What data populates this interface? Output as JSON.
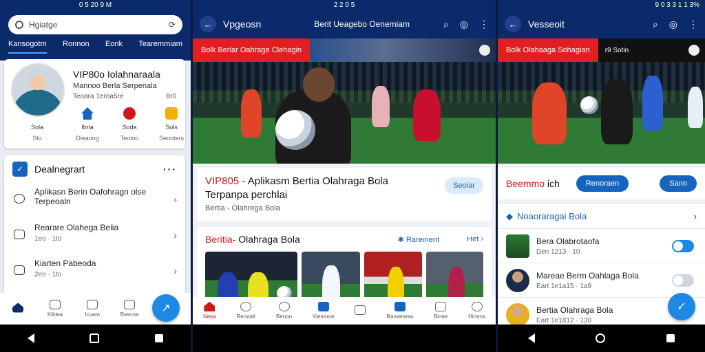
{
  "screen1": {
    "status": "0 5 20 9 M",
    "search": {
      "placeholder": "Hgiatge"
    },
    "tabs": [
      "Kansogotm",
      "Ronnon",
      "Eonk",
      "Tearemmiam"
    ],
    "profile": {
      "title": "VIP80o Iolahnaraala",
      "subtitle": "Mannoo Berla Serpenala",
      "meta_left": "Teoara 1eroa5re",
      "meta_right": "8r0",
      "avatar_caption1": "Sola",
      "avatar_caption2": "Sto",
      "quick": [
        {
          "label1": "Ibria",
          "label2": "Dieaong",
          "icon": "home-icon",
          "color": "#1565c0"
        },
        {
          "label1": "Soda",
          "label2": "Teoloo",
          "icon": "ball-icon",
          "color": "#d01818"
        },
        {
          "label1": "Sols",
          "label2": "Senntars",
          "icon": "ticket-icon",
          "color": "#f0b000"
        }
      ]
    },
    "list": {
      "heading": "Dealnegrart",
      "items": [
        {
          "title": "Aplikasn Berin Oafohragn olse Terpeoaln",
          "meta": ""
        },
        {
          "title": "Rearare Olahega Belia",
          "meta": "1eo · 1to"
        },
        {
          "title": "Kiarten Pabeoda",
          "meta": "2eo · 1to"
        }
      ]
    },
    "bottom_nav": [
      "",
      "Kiblea",
      "Icoam",
      "Bssnna"
    ]
  },
  "screen2": {
    "status": "2 2 0 5",
    "app_title": "Vpgeosn",
    "app_subtitle": "Berit Ueagebo Oenemiam",
    "banner": {
      "red_text": "Bolk Berlar Oahrage Clehagin"
    },
    "title_card": {
      "highlight": "VIP805",
      "title_rest": " - Aplikasm Bertia Olahraga Bola Terpanpa perchlai",
      "subtitle": "Bertia - Olahrega Bola",
      "pill": "Seoiar"
    },
    "news": {
      "highlight": "Beritia",
      "heading_rest": " - Olahraga Bola",
      "link1": "Rarement",
      "link2": "Het"
    },
    "bottom_tabs": [
      "Nesa",
      "Rerstalt",
      "Benoo",
      "Viemnoe",
      "",
      "Ramenesa",
      "Binee",
      "Himms"
    ]
  },
  "screen3": {
    "status": "9 0 3 3 1 1 3%",
    "app_title": "Vesseoit",
    "banner": {
      "red_text": "Bolk Olahaaga Sohagian",
      "rest_text": "r9 Sotin"
    },
    "row": {
      "highlight": "Beemmo",
      "text_rest": " ich",
      "btn1": "Renoraen",
      "btn2": "Sann"
    },
    "section": "Noaoraragai Bola",
    "items": [
      {
        "title": "Bera Olabrotaofa",
        "meta": "Den 1213 · 10",
        "switch": "on"
      },
      {
        "title": "Mareae Berm Oahlaga Bola",
        "meta": "Eart 1e1a15 · 1a9",
        "switch": "off"
      },
      {
        "title": "Bertia Olahraga Bola",
        "meta": "Eart 1e1812 · 130",
        "switch": "none"
      }
    ]
  }
}
